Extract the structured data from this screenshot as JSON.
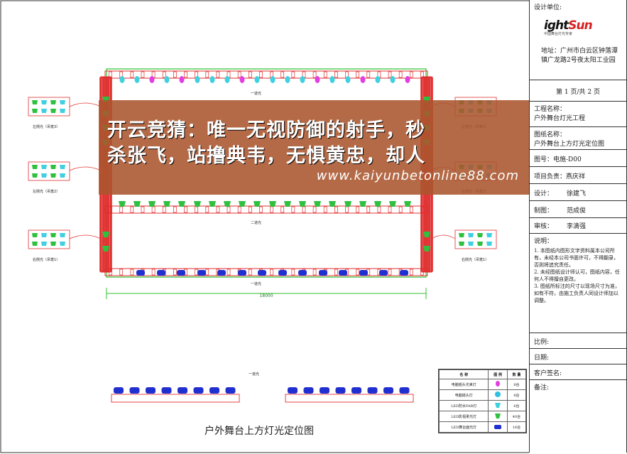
{
  "title_block": {
    "design_unit_label": "设计单位:",
    "logo_main_a": "ight",
    "logo_main_b": "Sun",
    "logo_sub": "中国舞台灯光专家",
    "address": "地址：广州市白云区钟落潭镇广龙路2号夜太阳工业园",
    "page": "第 1 页/共 2 页",
    "project_name_label": "工程名称：",
    "project_name": "户外舞台灯光工程",
    "drawing_name_label": "图纸名称：",
    "drawing_name": "户外舞台上方灯光定位图",
    "drawing_no": "图号：电施-D00",
    "project_lead": "项目负责：燕庆祥",
    "design_label": "设计：",
    "designer": "徐建飞",
    "draw_label": "制图：",
    "drafter": "范成俊",
    "review_label": "审核：",
    "reviewer": "李滴强",
    "notes_title": "说明：",
    "notes": [
      "1. 本图纸内图形文字资料属本公司所有，未经本公司书面许可，不得翻录，否则将追究责任。",
      "2. 未经图纸设计师认可，图纸内容，任何人不得擅自更改。",
      "3. 图纸所标注的尺寸以现场尺寸为准，如有不符，由施工负责人同设计师加以调整。"
    ],
    "scale_label": "比例:",
    "date_label": "日期:",
    "client_sign_label": "客户签名:",
    "remarks_label": "备注:"
  },
  "overlay": {
    "line1": "开云竞猜：唯一无视防御的射手，秒",
    "line2": "杀张飞，站撸典韦，无惧黄忠，却人",
    "url": "www.kaiyunbetonline88.com"
  },
  "drawing": {
    "truss_label_top": "一道光",
    "truss_label_mid": "二道光",
    "truss_label_bottom": "一道光",
    "dimension": "18000",
    "left_labels": [
      "左侧光（吊笼3）",
      "左侧光（吊笼2）",
      "右侧光（吊笼1）"
    ],
    "right_labels": [
      "左侧光（吊笼3）",
      "左侧光（吊笼2）",
      "右侧光（吊笼1）"
    ],
    "lower_truss_label": "一道光",
    "bottom_title": "户外舞台上方灯光定位图"
  },
  "legend": {
    "headers": [
      "名 称",
      "图 例",
      "数 量"
    ],
    "rows": [
      {
        "name": "电脑摇头光束灯",
        "qty": "8台",
        "color": "#e040e0"
      },
      {
        "name": "电脑摇头灯",
        "qty": "8台",
        "color": "#30c0e0"
      },
      {
        "name": "LED防水PAR灯",
        "qty": "6台",
        "color": "#40d0e0"
      },
      {
        "name": "LED影视柔光灯",
        "qty": "40台",
        "color": "#30c040"
      },
      {
        "name": "LED舞台面光灯",
        "qty": "16台",
        "color": "#2030d0"
      }
    ]
  }
}
